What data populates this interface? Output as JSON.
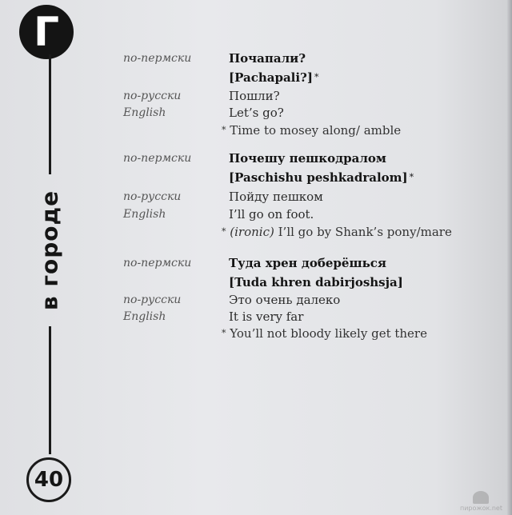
{
  "sidebar": {
    "letter": "Г",
    "section_title": "в городе",
    "page_number": "40"
  },
  "entries": [
    {
      "perm_label": "по-пермски",
      "perm_phrase": "Почапали?",
      "translit": "[Pachapali?]",
      "translit_mark": "*",
      "ru_label": "по-русски",
      "ru_text": "Пошли?",
      "en_label": "English",
      "en_text": "Let’s go?",
      "note_mark": "*",
      "note_prefix": "",
      "note_text": "Time to mosey along/ amble"
    },
    {
      "perm_label": "по-пермски",
      "perm_phrase": "Почешу пешкодралом",
      "translit": "[Paschishu peshkadralom]",
      "translit_mark": "*",
      "ru_label": "по-русски",
      "ru_text": "Пойду пешком",
      "en_label": "English",
      "en_text": "I’ll go on foot.",
      "note_mark": "*",
      "note_prefix": "(ironic)",
      "note_text": "I’ll go by Shank’s pony/mare"
    },
    {
      "perm_label": "по-пермски",
      "perm_phrase": "Туда хрен доберёшься",
      "translit": "[Tuda khren dabirjoshsja]",
      "translit_mark": "",
      "ru_label": "по-русски",
      "ru_text": "Это очень далеко",
      "en_label": "English",
      "en_text": "It is very far",
      "note_mark": "*",
      "note_prefix": "",
      "note_text": "You’ll not bloody likely get there"
    }
  ],
  "watermark": {
    "text": "пирожок.net"
  },
  "colors": {
    "ink": "#141414",
    "label": "#555555",
    "paper": "#e4e5e8"
  }
}
